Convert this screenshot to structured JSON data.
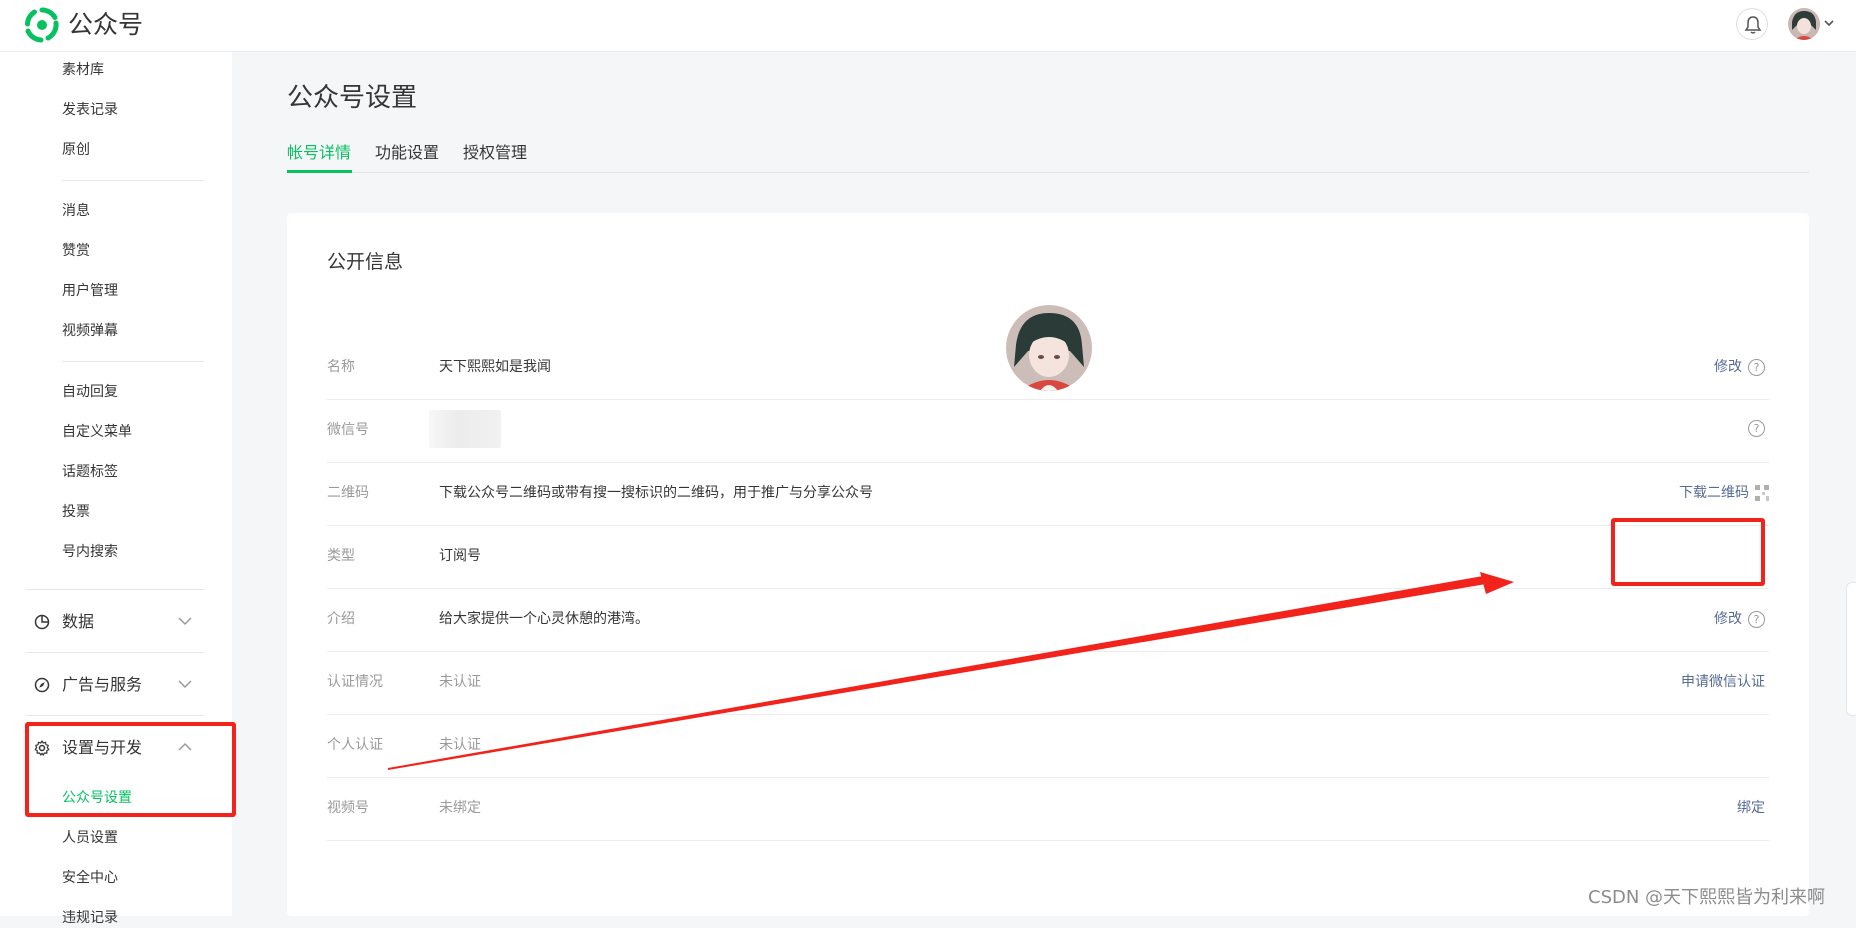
{
  "app": {
    "brand": "公众号",
    "logo_icon": "wechat-official-account-logo",
    "accent_color": "#07c160",
    "link_color": "#576b95",
    "annotation_color": "#f2231a"
  },
  "sidebar": {
    "items_top": [
      {
        "label": "素材库"
      },
      {
        "label": "发表记录"
      },
      {
        "label": "原创"
      }
    ],
    "items_mid": [
      {
        "label": "消息"
      },
      {
        "label": "赞赏"
      },
      {
        "label": "用户管理"
      },
      {
        "label": "视频弹幕"
      }
    ],
    "items_lower": [
      {
        "label": "自动回复"
      },
      {
        "label": "自定义菜单"
      },
      {
        "label": "话题标签"
      },
      {
        "label": "投票"
      },
      {
        "label": "号内搜索"
      }
    ],
    "groups": [
      {
        "label": "数据",
        "icon": "pie-chart-icon",
        "expanded": false
      },
      {
        "label": "广告与服务",
        "icon": "compass-icon",
        "expanded": false
      },
      {
        "label": "设置与开发",
        "icon": "gear-icon",
        "expanded": true
      }
    ],
    "settings_children": [
      {
        "label": "公众号设置",
        "active": true
      },
      {
        "label": "人员设置"
      },
      {
        "label": "安全中心"
      },
      {
        "label": "违规记录"
      }
    ]
  },
  "main": {
    "page_title": "公众号设置",
    "tabs": [
      {
        "label": "帐号详情",
        "active": true
      },
      {
        "label": "功能设置"
      },
      {
        "label": "授权管理"
      }
    ],
    "section_title": "公开信息",
    "rows": [
      {
        "label": "名称",
        "value": "天下熙熙如是我闻",
        "action": "修改",
        "help": "?"
      },
      {
        "label": "微信号",
        "value": "",
        "action": "",
        "help": "?"
      },
      {
        "label": "二维码",
        "value": "下载公众号二维码或带有搜一搜标识的二维码，用于推广与分享公众号",
        "action": "下载二维码"
      },
      {
        "label": "类型",
        "value": "订阅号",
        "action": ""
      },
      {
        "label": "介绍",
        "value": "给大家提供一个心灵休憩的港湾。",
        "action": "修改",
        "help": "?"
      },
      {
        "label": "认证情况",
        "value": "未认证",
        "action": "申请微信认证"
      },
      {
        "label": "个人认证",
        "value": "未认证",
        "action": ""
      },
      {
        "label": "视频号",
        "value": "未绑定",
        "action": "绑定"
      }
    ]
  },
  "watermark": "CSDN @天下熙熙皆为利来啊"
}
